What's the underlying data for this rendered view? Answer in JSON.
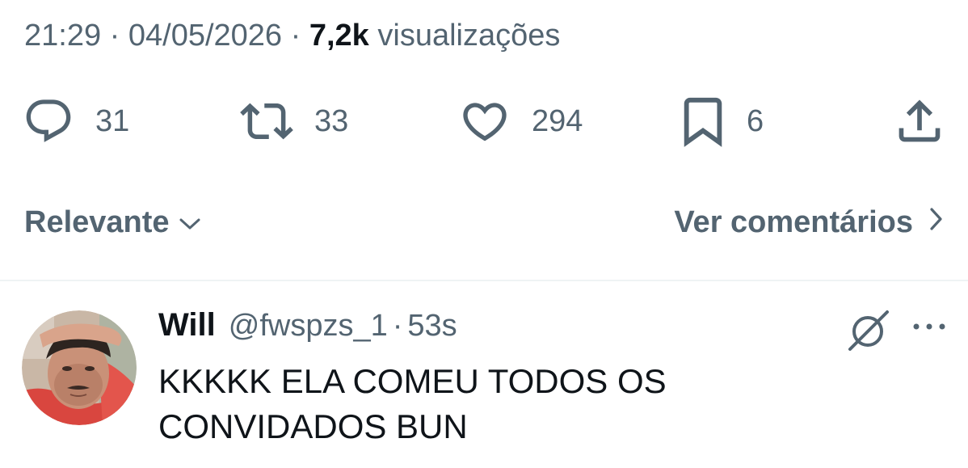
{
  "tweet_meta": {
    "time": "21:29",
    "separator": "·",
    "date": "04/05/2026",
    "views_count": "7,2k",
    "views_label": "visualizações"
  },
  "actions": {
    "replies": "31",
    "retweets": "33",
    "likes": "294",
    "bookmarks": "6"
  },
  "sort": {
    "label": "Relevante",
    "view_comments": "Ver comentários"
  },
  "reply": {
    "name": "Will",
    "handle": "@fwspzs_1",
    "separator": "·",
    "time": "53s",
    "text": "KKKKK ELA COMEU TODOS OS CONVIDADOS BUN"
  },
  "colors": {
    "secondary_text": "#536471",
    "primary_text": "#0f1419",
    "divider": "#eff3f4"
  },
  "icons": {
    "reply": "speech-bubble-icon",
    "retweet": "retweet-icon",
    "like": "heart-icon",
    "bookmark": "bookmark-icon",
    "share": "share-icon",
    "sort": "chevron-down-icon",
    "view_comments": "chevron-right-icon",
    "grok": "grok-icon",
    "more": "more-dots-icon"
  }
}
